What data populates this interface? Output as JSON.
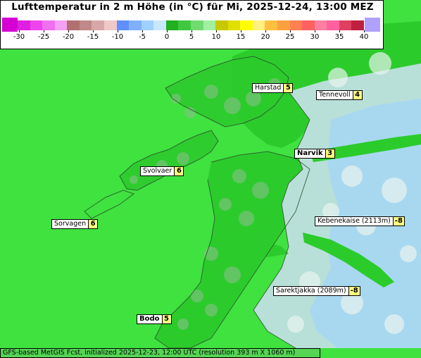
{
  "title": "Lufttemperatur in 2 m Höhe (in °C) für Mi, 2025-12-24, 13:00 MEZ",
  "footer": "GFS-based MetGIS Fcst, initialized 2025-12-23, 12:00 UTC  (resolution 393 m X 1060 m)",
  "scale": {
    "ticks": [
      "-30",
      "-25",
      "-20",
      "-15",
      "-10",
      "-5",
      "0",
      "5",
      "10",
      "15",
      "20",
      "25",
      "30",
      "35",
      "40"
    ],
    "colors": [
      "#e020e0",
      "#ee44ee",
      "#f070f0",
      "#f4a0f4",
      "#b07070",
      "#c08888",
      "#d8a8a8",
      "#f0c8c8",
      "#6090ff",
      "#80b0ff",
      "#a0d0ff",
      "#c8e8ff",
      "#20b020",
      "#40c840",
      "#70dc70",
      "#a0f0a0",
      "#c8c800",
      "#e0e000",
      "#ffff00",
      "#fff080",
      "#ffc040",
      "#ffa040",
      "#ff8050",
      "#ff6060",
      "#ff80a0",
      "#ff60a0",
      "#e04060",
      "#c02040"
    ],
    "low_cap_color": "#d400d4",
    "high_cap_color": "#b0a0ff"
  },
  "cities": [
    {
      "name": "Harstad",
      "value": "5",
      "bold": false
    },
    {
      "name": "Tennevoll",
      "value": "4",
      "bold": false
    },
    {
      "name": "Narvik",
      "value": "3",
      "bold": true
    },
    {
      "name": "Svolvaer",
      "value": "6",
      "bold": false
    },
    {
      "name": "Sorvagen",
      "value": "6",
      "bold": false
    },
    {
      "name": "Kebenekaise (2113m)",
      "value": "-8",
      "bold": false
    },
    {
      "name": "Sarektjakka (2089m)",
      "value": "-8",
      "bold": false
    },
    {
      "name": "Bodo",
      "value": "5",
      "bold": true
    }
  ]
}
